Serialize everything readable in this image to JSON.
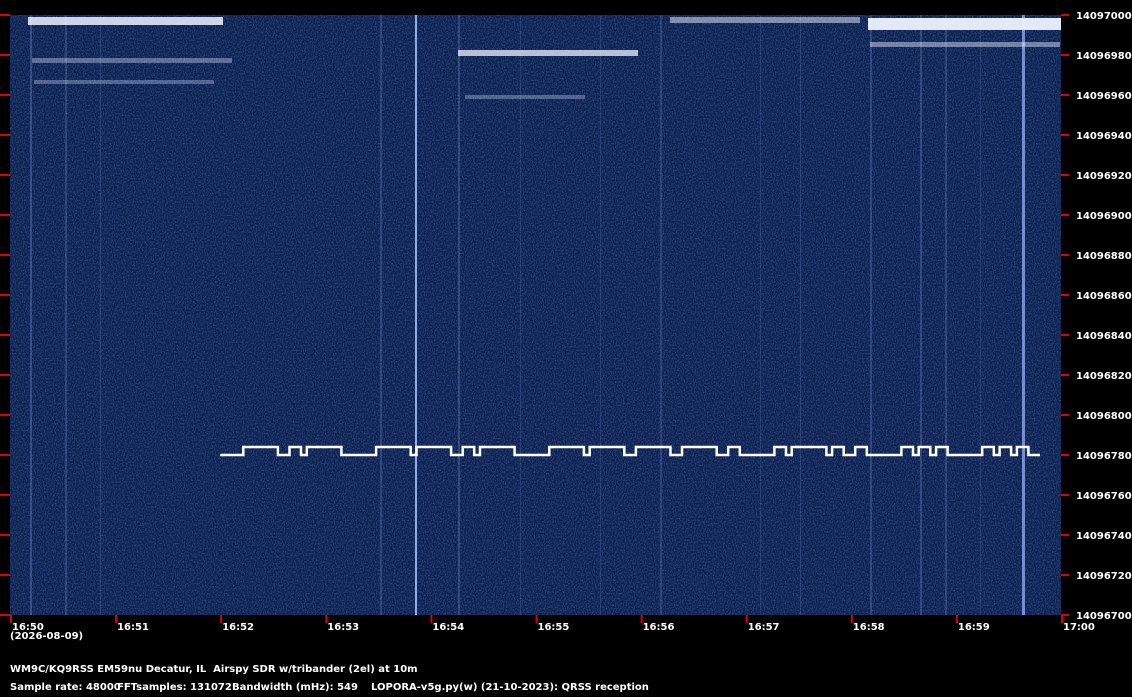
{
  "station": {
    "line1": "WM9C/KQ9RSS EM59nu Decatur, IL  Airspy SDR w/tribander (2el) at 10m",
    "sample_rate": "Sample rate: 48000",
    "fft_samples": "FFTsamples: 131072",
    "bandwidth": "Bandwidth (mHz): 549",
    "software": "LOPORA-v5g.py(w) (21-10-2023): QRSS reception"
  },
  "date_label": "(2026-08-09)",
  "colors": {
    "background": "#0a1f4d",
    "tick_marks": "#e00000",
    "signal": "#ffffff"
  },
  "chart_data": {
    "type": "heatmap",
    "title": "",
    "xlabel": "",
    "ylabel": "",
    "x_ticks": [
      "16:50",
      "16:51",
      "16:52",
      "16:53",
      "16:54",
      "16:55",
      "16:56",
      "16:57",
      "16:58",
      "16:59",
      "17:00"
    ],
    "y_ticks": [
      "14097000",
      "14096980",
      "14096960",
      "14096940",
      "14096920",
      "14096900",
      "14096880",
      "14096860",
      "14096840",
      "14096820",
      "14096800",
      "14096780",
      "14096760",
      "14096740",
      "14096720",
      "14096700"
    ],
    "xlim": [
      "16:50",
      "17:00"
    ],
    "ylim": [
      14096700,
      14097000
    ],
    "signals": [
      {
        "start": "16:52",
        "end": "16:59:48",
        "base_freq": 14096780,
        "shift_freq": 14096784,
        "mode": "FSK-CW",
        "keying": [
          0,
          0,
          0,
          0,
          1,
          1,
          1,
          1,
          1,
          1,
          0,
          0,
          1,
          1,
          0,
          1,
          1,
          1,
          1,
          1,
          1,
          0,
          0,
          0,
          0,
          0,
          0,
          1,
          1,
          1,
          1,
          1,
          1,
          0,
          1,
          1,
          1,
          1,
          1,
          1,
          0,
          0,
          1,
          1,
          0,
          1,
          1,
          1,
          1,
          1,
          1,
          0,
          0,
          0,
          0,
          0,
          0,
          1,
          1,
          1,
          1,
          1,
          1,
          0,
          1,
          1,
          1,
          1,
          1,
          1,
          0,
          0,
          1,
          1,
          1,
          1,
          1,
          1,
          0,
          0,
          1,
          1,
          1,
          1,
          1,
          1,
          0,
          0,
          1,
          1,
          0,
          0,
          0,
          0,
          0,
          0,
          1,
          1,
          0,
          1,
          1,
          1,
          1,
          1,
          1,
          0,
          1,
          1,
          0,
          0,
          1,
          1,
          0,
          0,
          0,
          0,
          0,
          0,
          1,
          1,
          0,
          1,
          1,
          0,
          1,
          1,
          0,
          0,
          0,
          0,
          0,
          0,
          1,
          1,
          0,
          1,
          1,
          0,
          1,
          1,
          0,
          0
        ]
      }
    ]
  }
}
